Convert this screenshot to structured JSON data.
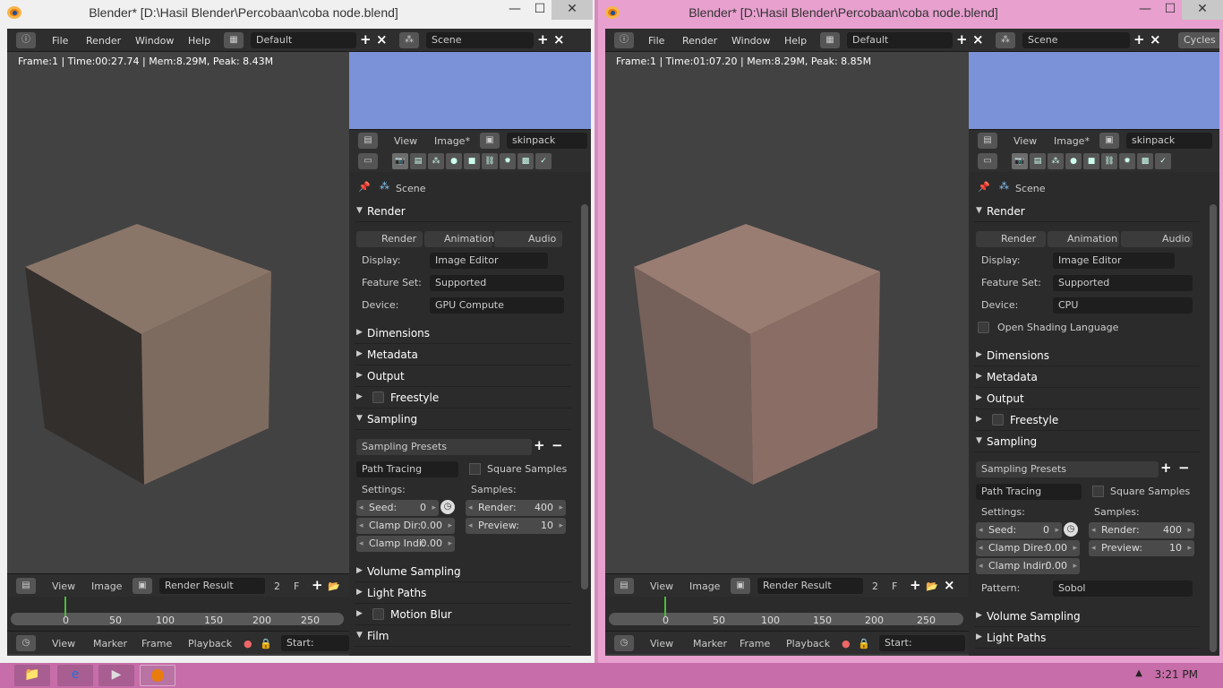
{
  "left": {
    "title": "Blender* [D:\\Hasil Blender\\Percobaan\\coba node.blend]",
    "menus": [
      "File",
      "Render",
      "Window",
      "Help"
    ],
    "layout": "Default",
    "scene": "Scene",
    "info": "Frame:1 | Time:00:27.74 | Mem:8.29M, Peak: 8.43M",
    "image_header": {
      "view": "View",
      "image": "Image*",
      "name": "skinpack"
    },
    "props_scene": "Scene",
    "render": {
      "panel": "Render",
      "render_btn": "Render",
      "animation_btn": "Animation",
      "audio_btn": "Audio",
      "display_label": "Display:",
      "display": "Image Editor",
      "feature_label": "Feature Set:",
      "feature": "Supported",
      "device_label": "Device:",
      "device": "GPU Compute"
    },
    "panels": [
      "Dimensions",
      "Metadata",
      "Output",
      "Freestyle",
      "Sampling"
    ],
    "sampling": {
      "presets": "Sampling Presets",
      "method": "Path Tracing",
      "square": "Square Samples",
      "settings": "Settings:",
      "samples": "Samples:",
      "seed_l": "Seed:",
      "seed_v": "0",
      "clamp_dir_l": "Clamp Dir:",
      "clamp_dir_v": "0.00",
      "clamp_ind_l": "Clamp Indi:",
      "clamp_ind_v": "0.00",
      "render_l": "Render:",
      "render_v": "400",
      "preview_l": "Preview:",
      "preview_v": "10"
    },
    "panels2": [
      "Volume Sampling",
      "Light Paths",
      "Motion Blur",
      "Film"
    ],
    "bottom": {
      "view": "View",
      "image": "Image",
      "result": "Render Result",
      "slot": "2",
      "f": "F"
    },
    "timeline_ticks": [
      "0",
      "50",
      "100",
      "150",
      "200",
      "250"
    ],
    "footer": {
      "view": "View",
      "marker": "Marker",
      "frame": "Frame",
      "playback": "Playback",
      "start": "Start:"
    }
  },
  "right": {
    "title": "Blender* [D:\\Hasil Blender\\Percobaan\\coba node.blend]",
    "menus": [
      "File",
      "Render",
      "Window",
      "Help"
    ],
    "layout": "Default",
    "scene": "Scene",
    "engine": "Cycles",
    "info": "Frame:1 | Time:01:07.20 | Mem:8.29M, Peak: 8.85M",
    "image_header": {
      "view": "View",
      "image": "Image*",
      "name": "skinpack"
    },
    "props_scene": "Scene",
    "render": {
      "panel": "Render",
      "render_btn": "Render",
      "animation_btn": "Animation",
      "audio_btn": "Audio",
      "display_label": "Display:",
      "display": "Image Editor",
      "feature_label": "Feature Set:",
      "feature": "Supported",
      "device_label": "Device:",
      "device": "CPU",
      "osl": "Open Shading Language"
    },
    "panels": [
      "Dimensions",
      "Metadata",
      "Output",
      "Freestyle",
      "Sampling"
    ],
    "sampling": {
      "presets": "Sampling Presets",
      "method": "Path Tracing",
      "square": "Square Samples",
      "settings": "Settings:",
      "samples": "Samples:",
      "seed_l": "Seed:",
      "seed_v": "0",
      "clamp_dir_l": "Clamp Dire:",
      "clamp_dir_v": "0.00",
      "clamp_ind_l": "Clamp Indir:",
      "clamp_ind_v": "0.00",
      "render_l": "Render:",
      "render_v": "400",
      "preview_l": "Preview:",
      "preview_v": "10",
      "pattern_l": "Pattern:",
      "pattern": "Sobol"
    },
    "panels2": [
      "Volume Sampling",
      "Light Paths"
    ],
    "bottom": {
      "view": "View",
      "image": "Image",
      "result": "Render Result",
      "slot": "2",
      "f": "F"
    },
    "timeline_ticks": [
      "0",
      "50",
      "100",
      "150",
      "200",
      "250"
    ],
    "footer": {
      "view": "View",
      "marker": "Marker",
      "frame": "Frame",
      "playback": "Playback",
      "start": "Start:"
    }
  },
  "taskbar": {
    "clock": "3:21 PM"
  },
  "colors": {
    "cube_left": "#7e6b5f",
    "cube_right": "#8a6e66",
    "preview": "#7b92d8",
    "taskbar": "#c76da9"
  }
}
